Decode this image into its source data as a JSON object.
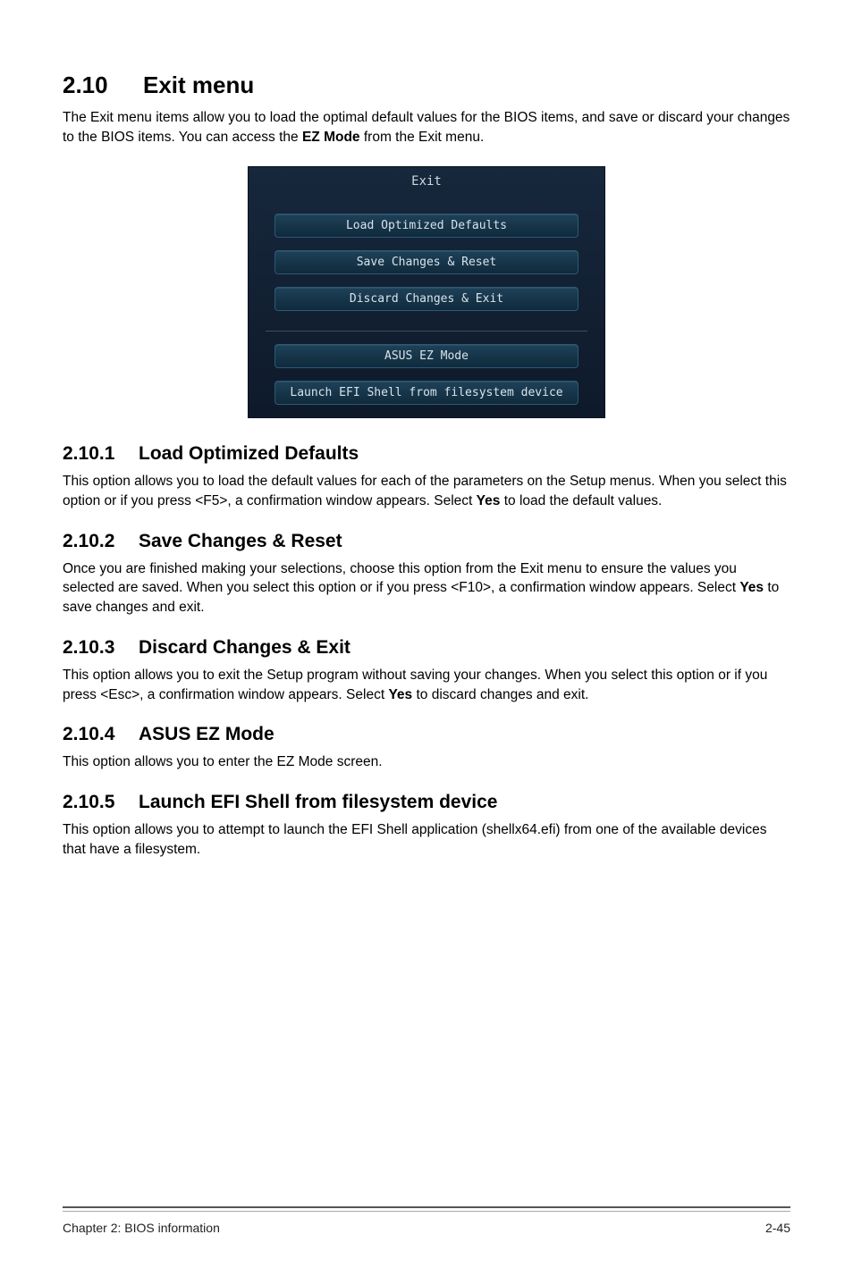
{
  "main_heading": {
    "num": "2.10",
    "title": "Exit menu"
  },
  "intro_1": "The Exit menu items allow you to load the optimal default values for the BIOS items, and save or discard your changes to the BIOS items. You can access the ",
  "intro_bold": "EZ Mode",
  "intro_2": " from the Exit menu.",
  "bios": {
    "title": "Exit",
    "btn1": "Load Optimized Defaults",
    "btn2": "Save Changes & Reset",
    "btn3": "Discard Changes & Exit",
    "btn4": "ASUS EZ Mode",
    "btn5": "Launch EFI Shell from filesystem device"
  },
  "s1": {
    "num": "2.10.1",
    "title": "Load Optimized Defaults",
    "p1": "This option allows you to load the default values for each of the parameters on the Setup menus. When you select this option or if you press <F5>, a confirmation window appears. Select ",
    "p1b": "Yes",
    "p2": " to load the default values."
  },
  "s2": {
    "num": "2.10.2",
    "title": "Save Changes & Reset",
    "p1": "Once you are finished making your selections, choose this option from the Exit menu to ensure the values you selected are saved. When you select this option or if you press <F10>, a confirmation window appears. Select ",
    "p1b": "Yes",
    "p2": " to save changes and exit."
  },
  "s3": {
    "num": "2.10.3",
    "title": "Discard Changes & Exit",
    "p1": "This option allows you to exit the Setup program without saving your changes. When you select this option or if you press <Esc>, a confirmation window appears. Select ",
    "p1b": "Yes",
    "p2": " to discard changes and exit."
  },
  "s4": {
    "num": "2.10.4",
    "title": "ASUS EZ Mode",
    "p1": "This option allows you to enter the EZ Mode screen."
  },
  "s5": {
    "num": "2.10.5",
    "title": "Launch EFI Shell from filesystem device",
    "p1": "This option allows you to attempt to launch the EFI Shell application (shellx64.efi) from one of the available devices that have a filesystem."
  },
  "footer": {
    "left": "Chapter 2: BIOS information",
    "right": "2-45"
  }
}
